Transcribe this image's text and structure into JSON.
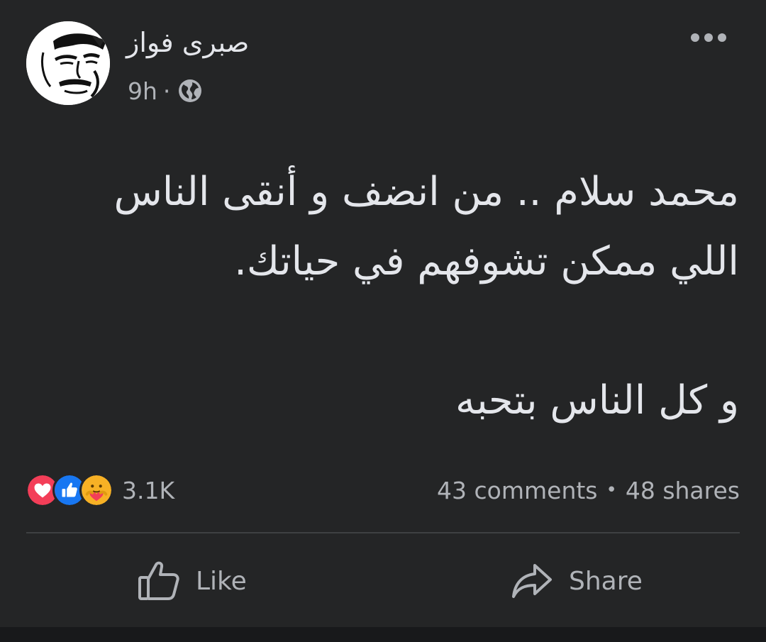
{
  "post": {
    "author": {
      "name": "صبرى فواز",
      "avatar_icon": "avatar-sketch-face"
    },
    "timestamp": "9h",
    "separator": "·",
    "audience_icon": "globe-icon",
    "more_icon": "more-dots-icon",
    "text_lines": [
      "محمد سلام .. من انضف و أنقى الناس اللي ممكن تشوفهم في حياتك.",
      "و كل الناس بتحبه"
    ]
  },
  "engagement": {
    "reaction_icons": [
      "love-reaction-icon",
      "like-reaction-icon",
      "care-reaction-icon"
    ],
    "reaction_count": "3.1K",
    "comments": "43 comments",
    "dot": "•",
    "shares": "48 shares"
  },
  "actions": {
    "like_label": "Like",
    "like_icon": "thumbs-up-outline-icon",
    "share_label": "Share",
    "share_icon": "share-arrow-icon"
  },
  "colors": {
    "background": "#242526",
    "text_primary": "#e4e6eb",
    "text_secondary": "#b0b3b8",
    "like_blue": "#1877f2",
    "love_red": "#f33e58",
    "care_yellow": "#f7b125"
  }
}
